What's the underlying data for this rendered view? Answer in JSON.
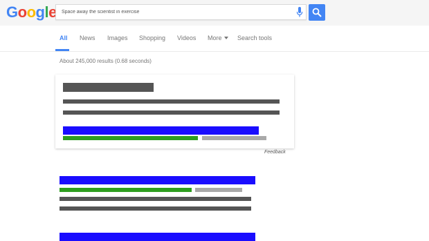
{
  "logo": {
    "letters": [
      "G",
      "o",
      "o",
      "g",
      "l",
      "e"
    ],
    "colors": [
      "#4285f4",
      "#ea4335",
      "#fbbc05",
      "#4285f4",
      "#34a853",
      "#ea4335"
    ]
  },
  "search": {
    "value": "Space away the scientist in exercise",
    "mic_icon": "microphone-icon",
    "button_icon": "magnifier-icon"
  },
  "tabs": [
    {
      "label": "All",
      "active": true
    },
    {
      "label": "News",
      "active": false
    },
    {
      "label": "Images",
      "active": false
    },
    {
      "label": "Shopping",
      "active": false
    },
    {
      "label": "Videos",
      "active": false
    },
    {
      "label": "More",
      "active": false,
      "dropdown": true
    },
    {
      "label": "Search tools",
      "active": false
    }
  ],
  "stats": "About 245,000 results (0.68 seconds)",
  "featured_snippet": {
    "feedback_label": "Feedback"
  },
  "colors": {
    "title_bar": "#1a0dff",
    "url_bar": "#2e9e1f",
    "meta_bar": "#a9a9a9",
    "text_bar": "#555555",
    "accent": "#4285f4"
  }
}
